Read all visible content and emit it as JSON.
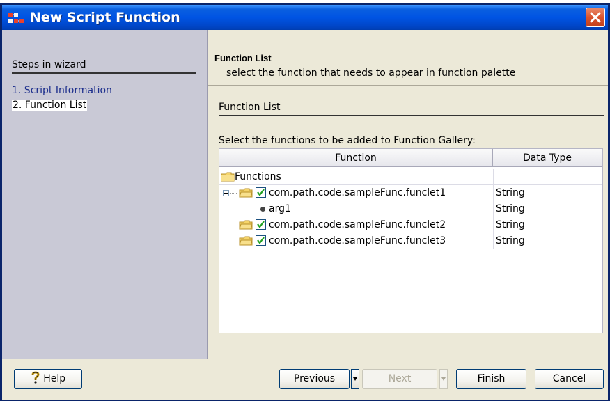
{
  "window": {
    "title": "New Script Function",
    "title_icon": "script-function-icon",
    "close_icon": "close-icon"
  },
  "wizard": {
    "title": "Steps in wizard",
    "steps": [
      "1. Script Information",
      "2. Function List"
    ],
    "current_step": 2
  },
  "header": {
    "title": "Function List",
    "subtitle": "select the function that needs to appear in function palette"
  },
  "content": {
    "group_title": "Function List",
    "instruction": "Select the functions to be added to Function Gallery:",
    "columns": [
      "Function",
      "Data Type"
    ],
    "rows": [
      {
        "label": "Functions",
        "type": "",
        "icon": "folder-icon"
      },
      {
        "label": "com.path.code.sampleFunc.funclet1",
        "type": "String",
        "icon": "folder-icon",
        "checked": true,
        "expanded": true
      },
      {
        "label": "arg1",
        "type": "String",
        "icon": "leaf-dot-icon"
      },
      {
        "label": "com.path.code.sampleFunc.funclet2",
        "type": "String",
        "icon": "folder-icon",
        "checked": true
      },
      {
        "label": "com.path.code.sampleFunc.funclet3",
        "type": "String",
        "icon": "folder-icon",
        "checked": true
      }
    ]
  },
  "buttons": {
    "help": "Help",
    "help_icon": "help-question-icon",
    "previous": "Previous",
    "next": "Next",
    "next_enabled": false,
    "finish": "Finish",
    "cancel": "Cancel"
  },
  "colors": {
    "title_bar": "#0054E3",
    "left_panel": "#C9C9D6",
    "dialog_bg": "#ECE9D8",
    "check": "#21A121"
  }
}
